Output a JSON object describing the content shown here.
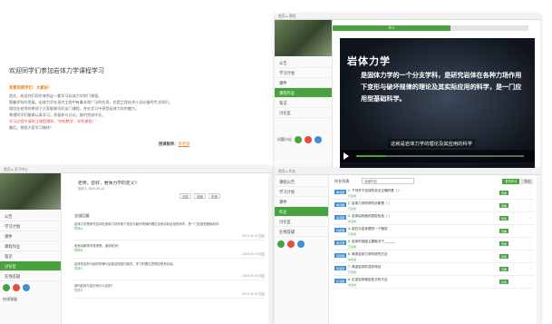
{
  "letter": {
    "title": "欢迎同学们参加岩体力学课程学习",
    "greeting": "亲爱的同学们：大家好！",
    "paragraphs": [
      "首先，欢迎你们同学来到这一都学习岩体力学的门课程。",
      "随着学科的发展，岩体力学在现代工程中有着非常广泛的应用，也是工程技术人员必备的专业知识。",
      "相信在老师的带领下大家能够学好这门课程，并在学习中感受岩体力学的魅力。",
      "希望同学们能够认真学习，积极参与讨论，按时完成作业。",
      "学习过程中请关注课程通知，“你的教学，学的课程！”",
      "最后，预祝大家学习愉快！"
    ],
    "signature_label": "授课教师：",
    "signature_name": "李老师"
  },
  "video_app": {
    "topbar": "首页 ▸ 课程",
    "green_tab": "学习",
    "sidebar": [
      "公告",
      "学习计划",
      "课件",
      "课程作业",
      "笔记",
      "讨论区"
    ],
    "active_index": 3,
    "video_title": "岩体力学",
    "video_text": "是固体力学的一个分支学科，是研究岩体在各种力场作用下变形与破坏规律的理论及其实际应用的科学，是一门应用型基础科学。",
    "subtitle": "这就是岩体力学的理论及其应用的科学",
    "tools_label": "问题讨论"
  },
  "discussion_app": {
    "topbar": "首页 ▸ 学习中心",
    "sidebar": [
      "公告",
      "学习计划",
      "课件",
      "课程作业",
      "笔记",
      "讨论区",
      "在线答疑"
    ],
    "active_index": 5,
    "post_title": "老师，您好，岩体力学的定义？",
    "post_meta": "发帖人  2019-05-14",
    "buttons": [
      "回复",
      "收藏",
      "举报"
    ],
    "all_replies": "全部回复",
    "posts": [
      {
        "text": "岩体力学是研究岩体在各种力场作用下变形与破坏规律的理论及其实际应用的科学，是一门应用型基础科学。",
        "meta": "同学A",
        "right": "2019-05-14 回复"
      },
      {
        "text": "老师讲解得非常清楚，谢谢老师！",
        "meta": "同学B",
        "right": "2019-05-14 回复"
      },
      {
        "text": "岩体的变形与破坏规律与岩体结构密切相关，学习时要注意理论联系实际。",
        "meta": "同学C",
        "right": "2019-05-15 回复"
      },
      {
        "text": "请问岩体与岩石有什么区别？",
        "meta": "同学D",
        "right": "2019-05-15 回复"
      }
    ],
    "tools_label": "在线答疑"
  },
  "exercise_app": {
    "topbar": "首页 ▸ 作业",
    "sidebar": [
      "课程公告",
      "学习计划",
      "课件",
      "作业",
      "讨论区",
      "在线答疑"
    ],
    "active_index": 3,
    "header": "作业列表",
    "select_value": "全部作业",
    "header_buttons": [
      "发布作业",
      "导出"
    ],
    "rows": [
      {
        "tag": "单选题",
        "q": "1. 下列关于岩体的说法正确的是（ ）",
        "s": "已完成",
        "b": "查看"
      },
      {
        "tag": "单选题",
        "q": "2. 岩体力学的研究对象是（ ）",
        "s": "已完成",
        "b": "查看"
      },
      {
        "tag": "多选题",
        "q": "3. 岩体结构面的类型包括（ ）",
        "s": "未完成",
        "b": "作答"
      },
      {
        "tag": "判断题",
        "q": "4. 岩石与岩体是同一个概念",
        "s": "已完成",
        "b": "查看"
      },
      {
        "tag": "填空题",
        "q": "5. 岩体的强度主要取决于______",
        "s": "已完成",
        "b": "查看"
      },
      {
        "tag": "简答题",
        "q": "6. 简述岩体力学的研究方法",
        "s": "未完成",
        "b": "作答"
      },
      {
        "tag": "简答题",
        "q": "7. 简述岩体的变形特征",
        "s": "已完成",
        "b": "查看"
      },
      {
        "tag": "论述题",
        "q": "8. 论述岩体稳定性分析方法",
        "s": "未完成",
        "b": "作答"
      }
    ]
  },
  "colors": {
    "green": "#48a33f",
    "orange": "#e67e22",
    "red": "#e74c3c",
    "blue": "#3d8fd6"
  }
}
